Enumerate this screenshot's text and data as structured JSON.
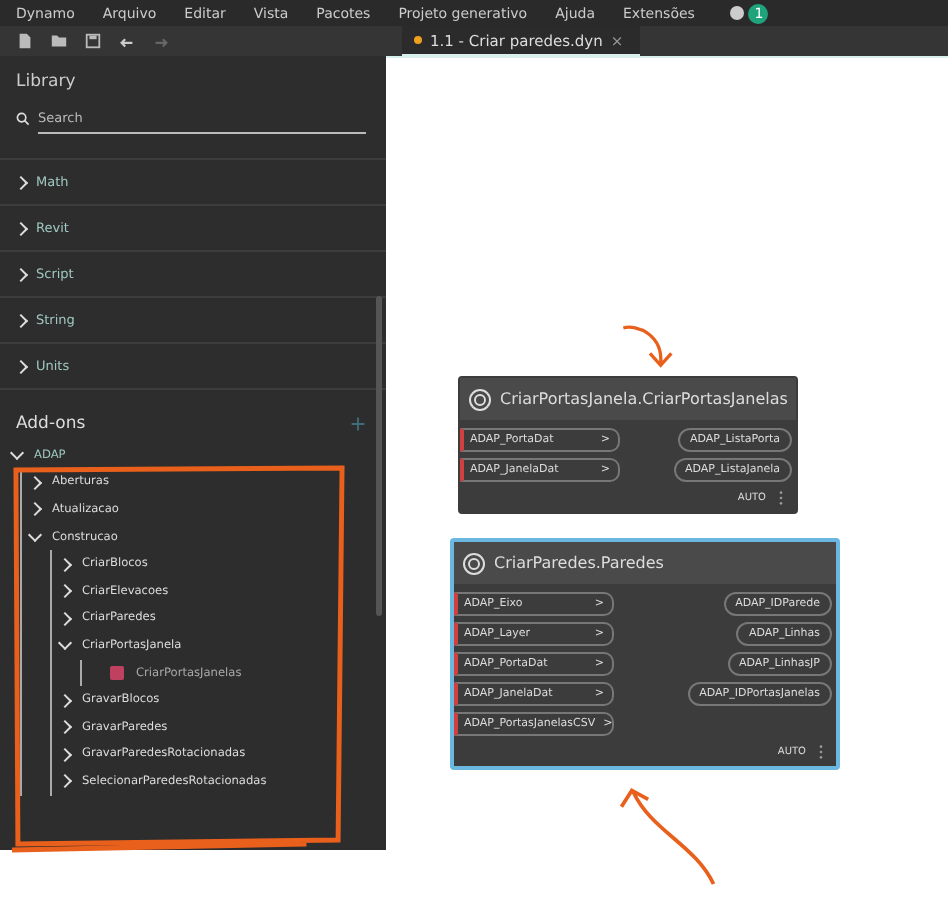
{
  "menu": [
    "Dynamo",
    "Arquivo",
    "Editar",
    "Vista",
    "Pacotes",
    "Projeto generativo",
    "Ajuda",
    "Extensões"
  ],
  "notification_badge": "1",
  "tab": {
    "label": "1.1 - Criar paredes.dyn",
    "modified": true,
    "close": "×"
  },
  "library": {
    "title": "Library",
    "search": {
      "placeholder": "Search"
    },
    "categories": [
      {
        "label": "Math",
        "expanded": false
      },
      {
        "label": "Revit",
        "expanded": false
      },
      {
        "label": "Script",
        "expanded": false
      },
      {
        "label": "String",
        "expanded": false
      },
      {
        "label": "Units",
        "expanded": false
      }
    ],
    "addons_title": "Add-ons",
    "tree": [
      {
        "label": "ADAP",
        "kind": "folder",
        "expanded": true,
        "children": [
          {
            "label": "Aberturas",
            "kind": "folder",
            "expanded": false
          },
          {
            "label": "Atualizacao",
            "kind": "folder",
            "expanded": false
          },
          {
            "label": "Construcao",
            "kind": "folder",
            "expanded": true,
            "children": [
              {
                "label": "CriarBlocos",
                "kind": "folder",
                "expanded": false
              },
              {
                "label": "CriarElevacoes",
                "kind": "folder",
                "expanded": false
              },
              {
                "label": "CriarParedes",
                "kind": "folder",
                "expanded": false
              },
              {
                "label": "CriarPortasJanela",
                "kind": "folder",
                "expanded": true,
                "children": [
                  {
                    "label": "CriarPortasJanelas",
                    "kind": "node"
                  }
                ]
              },
              {
                "label": "GravarBlocos",
                "kind": "folder",
                "expanded": false
              },
              {
                "label": "GravarParedes",
                "kind": "folder",
                "expanded": false
              },
              {
                "label": "GravarParedesRotacionadas",
                "kind": "folder",
                "expanded": false
              },
              {
                "label": "SelecionarParedesRotacionadas",
                "kind": "folder",
                "expanded": false
              }
            ]
          }
        ]
      }
    ]
  },
  "port_arrow": ">",
  "nodes": [
    {
      "title": "CriarPortasJanela.CriarPortasJanelas",
      "selected": false,
      "inputs": [
        "ADAP_PortaDat",
        "ADAP_JanelaDat"
      ],
      "outputs": [
        "ADAP_ListaPorta",
        "ADAP_ListaJanela"
      ],
      "lacing": "AUTO"
    },
    {
      "title": "CriarParedes.Paredes",
      "selected": true,
      "inputs": [
        "ADAP_Eixo",
        "ADAP_Layer",
        "ADAP_PortaDat",
        "ADAP_JanelaDat",
        "ADAP_PortasJanelasCSV"
      ],
      "outputs": [
        "ADAP_IDParede",
        "ADAP_Linhas",
        "ADAP_LinhasJP",
        "ADAP_IDPortasJanelas"
      ],
      "lacing": "AUTO"
    }
  ]
}
